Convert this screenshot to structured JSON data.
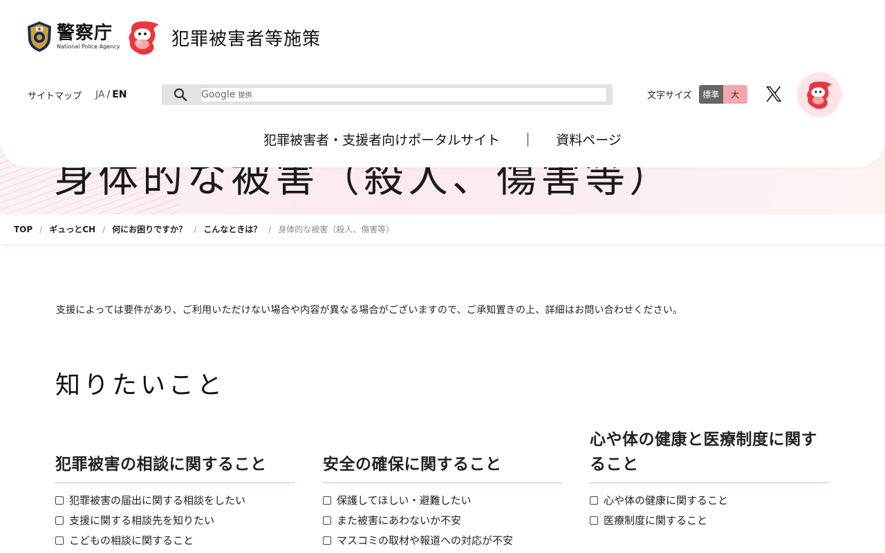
{
  "header": {
    "npa_name": "警察庁",
    "npa_en": "National Police Agency",
    "site_title": "犯罪被害者等施策",
    "sitemap": "サイトマップ",
    "lang_ja": "JA",
    "lang_sep": "/",
    "lang_en": "EN",
    "search": {
      "brand": "Google",
      "provided": "提供"
    },
    "fontsize": {
      "label": "文字サイズ",
      "standard": "標準",
      "large": "大"
    }
  },
  "gnav": [
    {
      "label": "犯罪被害者・支援者向けポータルサイト"
    },
    {
      "label": "資料ページ"
    }
  ],
  "hero": {
    "title": "身体的な被害（殺人、傷害等）"
  },
  "breadcrumb": [
    "TOP",
    "ギュっとCH",
    "何にお困りですか？",
    "こんなときは？",
    "身体的な被害（殺人、傷害等）"
  ],
  "breadcrumb_sep": "/",
  "notice": "支援によっては要件があり、ご利用いただけない場合や内容が異なる場合がございますので、ご承知置きの上、詳細はお問い合わせください。",
  "section_title": "知りたいこと",
  "columns": [
    {
      "heading": "犯罪被害の相談に関すること",
      "items": [
        "犯罪被害の届出に関する相談をしたい",
        "支援に関する相談先を知りたい",
        "こどもの相談に関すること"
      ]
    },
    {
      "heading": "安全の確保に関すること",
      "items": [
        "保護してほしい・避難したい",
        "また被害にあわないか不安",
        "マスコミの取材や報道への対応が不安"
      ]
    },
    {
      "heading": "心や体の健康と医療制度に関すること",
      "items": [
        "心や体の健康に関すること",
        "医療制度に関すること"
      ]
    }
  ],
  "colors": {
    "accent_pink": "#f4a6ad",
    "standard_btn": "#666666",
    "mascot_red": "#e8383d"
  }
}
